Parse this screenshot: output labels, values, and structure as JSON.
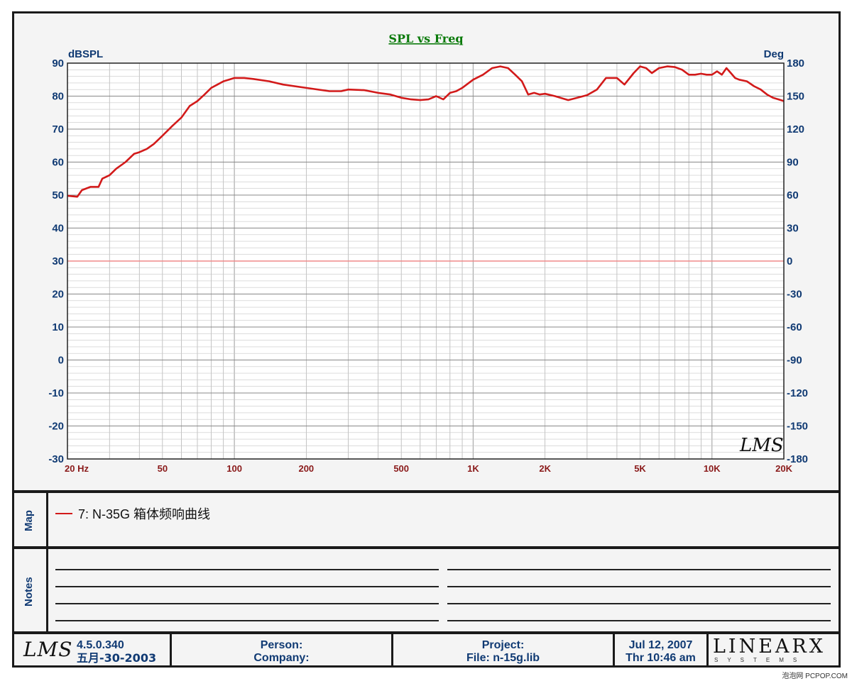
{
  "chart_data": {
    "type": "line",
    "title": "SPL vs Freq",
    "ylabel": "dBSPL",
    "y2label": "Deg",
    "x_scale": "log",
    "xlim": [
      20,
      20000
    ],
    "ylim": [
      -30,
      90
    ],
    "y2lim": [
      -180,
      180
    ],
    "grid": true,
    "x_ticks": [
      {
        "value": 20,
        "label": "20  Hz"
      },
      {
        "value": 50,
        "label": "50"
      },
      {
        "value": 100,
        "label": "100"
      },
      {
        "value": 200,
        "label": "200"
      },
      {
        "value": 500,
        "label": "500"
      },
      {
        "value": 1000,
        "label": "1K"
      },
      {
        "value": 2000,
        "label": "2K"
      },
      {
        "value": 5000,
        "label": "5K"
      },
      {
        "value": 10000,
        "label": "10K"
      },
      {
        "value": 20000,
        "label": "20K"
      }
    ],
    "y_ticks": [
      90,
      80,
      70,
      60,
      50,
      40,
      30,
      20,
      10,
      0,
      -10,
      -20,
      -30
    ],
    "y2_ticks": [
      180,
      150,
      120,
      90,
      60,
      30,
      0,
      -30,
      -60,
      -90,
      -120,
      -150,
      -180
    ],
    "reference_line": {
      "y": 30
    },
    "series": [
      {
        "name": "7: N-35G 箱体频响曲线",
        "color": "#d21a1a",
        "x": [
          20,
          22,
          23,
          25,
          27,
          28,
          30,
          32,
          35,
          38,
          40,
          43,
          46,
          50,
          55,
          60,
          65,
          70,
          75,
          80,
          85,
          90,
          95,
          100,
          110,
          120,
          140,
          160,
          200,
          250,
          280,
          300,
          350,
          400,
          450,
          500,
          550,
          600,
          650,
          700,
          750,
          800,
          850,
          900,
          1000,
          1100,
          1200,
          1300,
          1400,
          1500,
          1600,
          1700,
          1800,
          1900,
          2000,
          2200,
          2500,
          3000,
          3300,
          3600,
          3800,
          4000,
          4300,
          4700,
          5000,
          5300,
          5600,
          6000,
          6500,
          7000,
          7500,
          8000,
          8500,
          9000,
          9500,
          10000,
          10500,
          11000,
          11500,
          12000,
          12500,
          13000,
          14000,
          15000,
          16000,
          17000,
          18000,
          19000,
          20000
        ],
        "y": [
          49.8,
          49.5,
          51.5,
          52.5,
          52.5,
          55,
          56,
          58,
          60,
          62.5,
          63,
          64,
          65.5,
          68,
          71,
          73.5,
          77,
          78.5,
          80.5,
          82.5,
          83.5,
          84.5,
          85,
          85.5,
          85.5,
          85.2,
          84.5,
          83.5,
          82.5,
          81.5,
          81.5,
          82,
          81.8,
          81,
          80.5,
          79.5,
          79,
          78.8,
          79,
          80,
          79,
          81,
          81.5,
          82.5,
          85,
          86.5,
          88.5,
          89,
          88.5,
          86.5,
          84.5,
          80.5,
          81,
          80.5,
          80.7,
          80,
          78.8,
          80.3,
          82,
          85.5,
          85.5,
          85.5,
          83.5,
          87,
          89,
          88.5,
          87,
          88.5,
          89,
          88.8,
          88,
          86.5,
          86.5,
          86.8,
          86.5,
          86.5,
          87.5,
          86.5,
          88.5,
          87,
          85.5,
          85,
          84.5,
          83,
          82,
          80.5,
          79.5,
          79,
          78.5
        ]
      }
    ]
  },
  "map_panel": {
    "label": "Map",
    "entry": "7: N-35G 箱体频响曲线"
  },
  "notes_panel": {
    "label": "Notes"
  },
  "footer": {
    "logo": "LMS",
    "version": "4.5.0.340",
    "version_date": "五月-30-2003",
    "person_label": "Person:",
    "company_label": "Company:",
    "project_label": "Project:",
    "file_label": "File: n-15g.lib",
    "date": "Jul 12, 2007",
    "time": "Thr 10:46 am",
    "brand": "LINEARX",
    "brand_sub": "SYSTEMS"
  },
  "chart_logo": "LMS",
  "watermark": "泡泡网  PCPOP.COM",
  "colors": {
    "trace": "#d21a1a",
    "reference": "#f08a8a",
    "tick_y": "#103a73",
    "tick_x": "#8a1a1a",
    "title": "#0a7a0a",
    "grid": "#aaaaaa"
  }
}
